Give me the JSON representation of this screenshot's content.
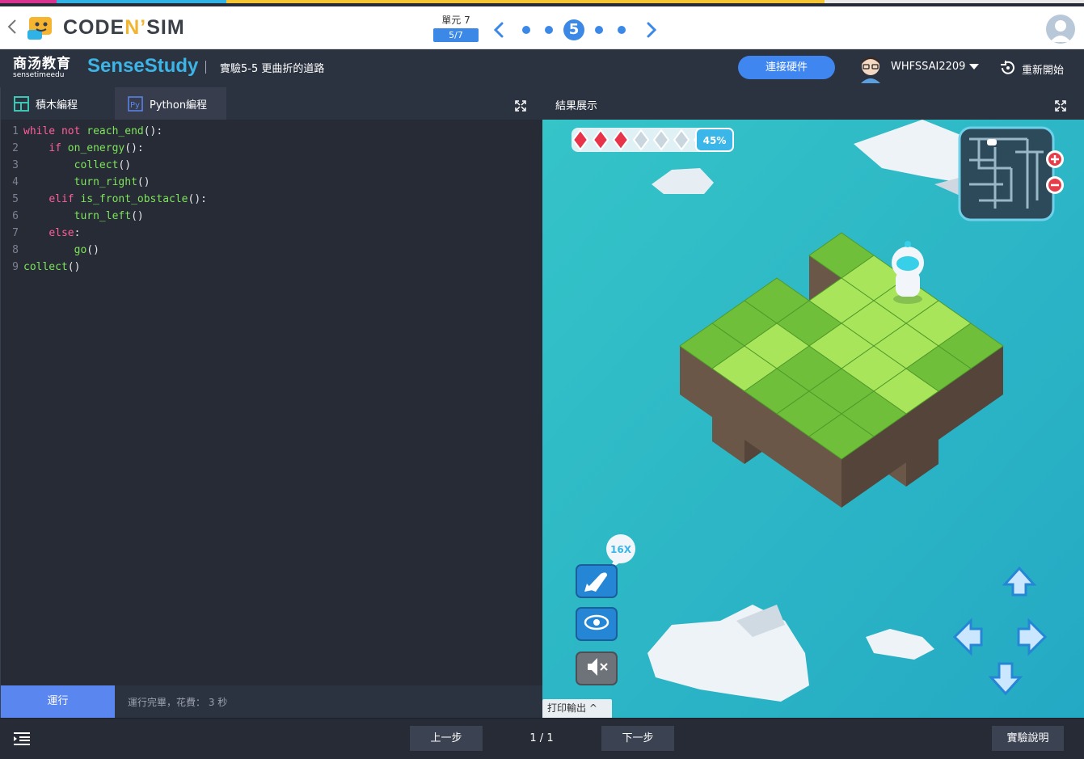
{
  "colors": {
    "accent": "#3c88e6",
    "run": "#5a86ef",
    "connect": "#3f86f0",
    "keyword": "#ff5f99",
    "function": "#7ee55a",
    "water": "#2fb9c4",
    "grass": "#7ccf3a"
  },
  "header": {
    "logo_left": "CODE",
    "logo_n": "N",
    "logo_apos": "’",
    "logo_right": "SIM",
    "unit_title": "單元 7",
    "unit_progress": "5/7",
    "current_step": "5"
  },
  "subheader": {
    "brand_cn": "商汤教育",
    "brand_en": "sensetimeedu",
    "brand2": "SenseStudy",
    "lesson": "實驗5-5  更曲折的道路",
    "connect": "連接硬件",
    "username": "WHFSSAI2209",
    "restart": "重新開始"
  },
  "editor": {
    "tab_blocks": "積木編程",
    "tab_python": "Python編程",
    "lines": [
      {
        "num": "1",
        "indent": "",
        "parts": [
          [
            "kw",
            "while"
          ],
          [
            "pn",
            " "
          ],
          [
            "kw",
            "not"
          ],
          [
            "pn",
            " "
          ],
          [
            "fn",
            "reach_end"
          ],
          [
            "pn",
            "():"
          ]
        ]
      },
      {
        "num": "2",
        "indent": "    ",
        "parts": [
          [
            "kw",
            "if"
          ],
          [
            "pn",
            " "
          ],
          [
            "fn",
            "on_energy"
          ],
          [
            "pn",
            "():"
          ]
        ]
      },
      {
        "num": "3",
        "indent": "        ",
        "parts": [
          [
            "fn",
            "collect"
          ],
          [
            "pn",
            "()"
          ]
        ]
      },
      {
        "num": "4",
        "indent": "        ",
        "parts": [
          [
            "fn",
            "turn_right"
          ],
          [
            "pn",
            "()"
          ]
        ]
      },
      {
        "num": "5",
        "indent": "    ",
        "parts": [
          [
            "kw",
            "elif"
          ],
          [
            "pn",
            " "
          ],
          [
            "fn",
            "is_front_obstacle"
          ],
          [
            "pn",
            "():"
          ]
        ]
      },
      {
        "num": "6",
        "indent": "        ",
        "parts": [
          [
            "fn",
            "turn_left"
          ],
          [
            "pn",
            "()"
          ]
        ]
      },
      {
        "num": "7",
        "indent": "    ",
        "parts": [
          [
            "kw",
            "else"
          ],
          [
            "pn",
            ":"
          ]
        ]
      },
      {
        "num": "8",
        "indent": "        ",
        "parts": [
          [
            "fn",
            "go"
          ],
          [
            "pn",
            "()"
          ]
        ]
      },
      {
        "num": "9",
        "indent": "",
        "parts": [
          [
            "fn",
            "collect"
          ],
          [
            "pn",
            "()"
          ]
        ]
      }
    ],
    "run": "運行",
    "status": "運行完畢，花費： 3 秒"
  },
  "result": {
    "title": "結果展示",
    "energy_percent": "45%",
    "speed": "16X",
    "print_output": "打印輸出",
    "gems_filled": 3,
    "gems_total": 7
  },
  "footer": {
    "prev": "上一步",
    "page": "1 / 1",
    "next": "下一步",
    "instructions": "實驗說明"
  }
}
